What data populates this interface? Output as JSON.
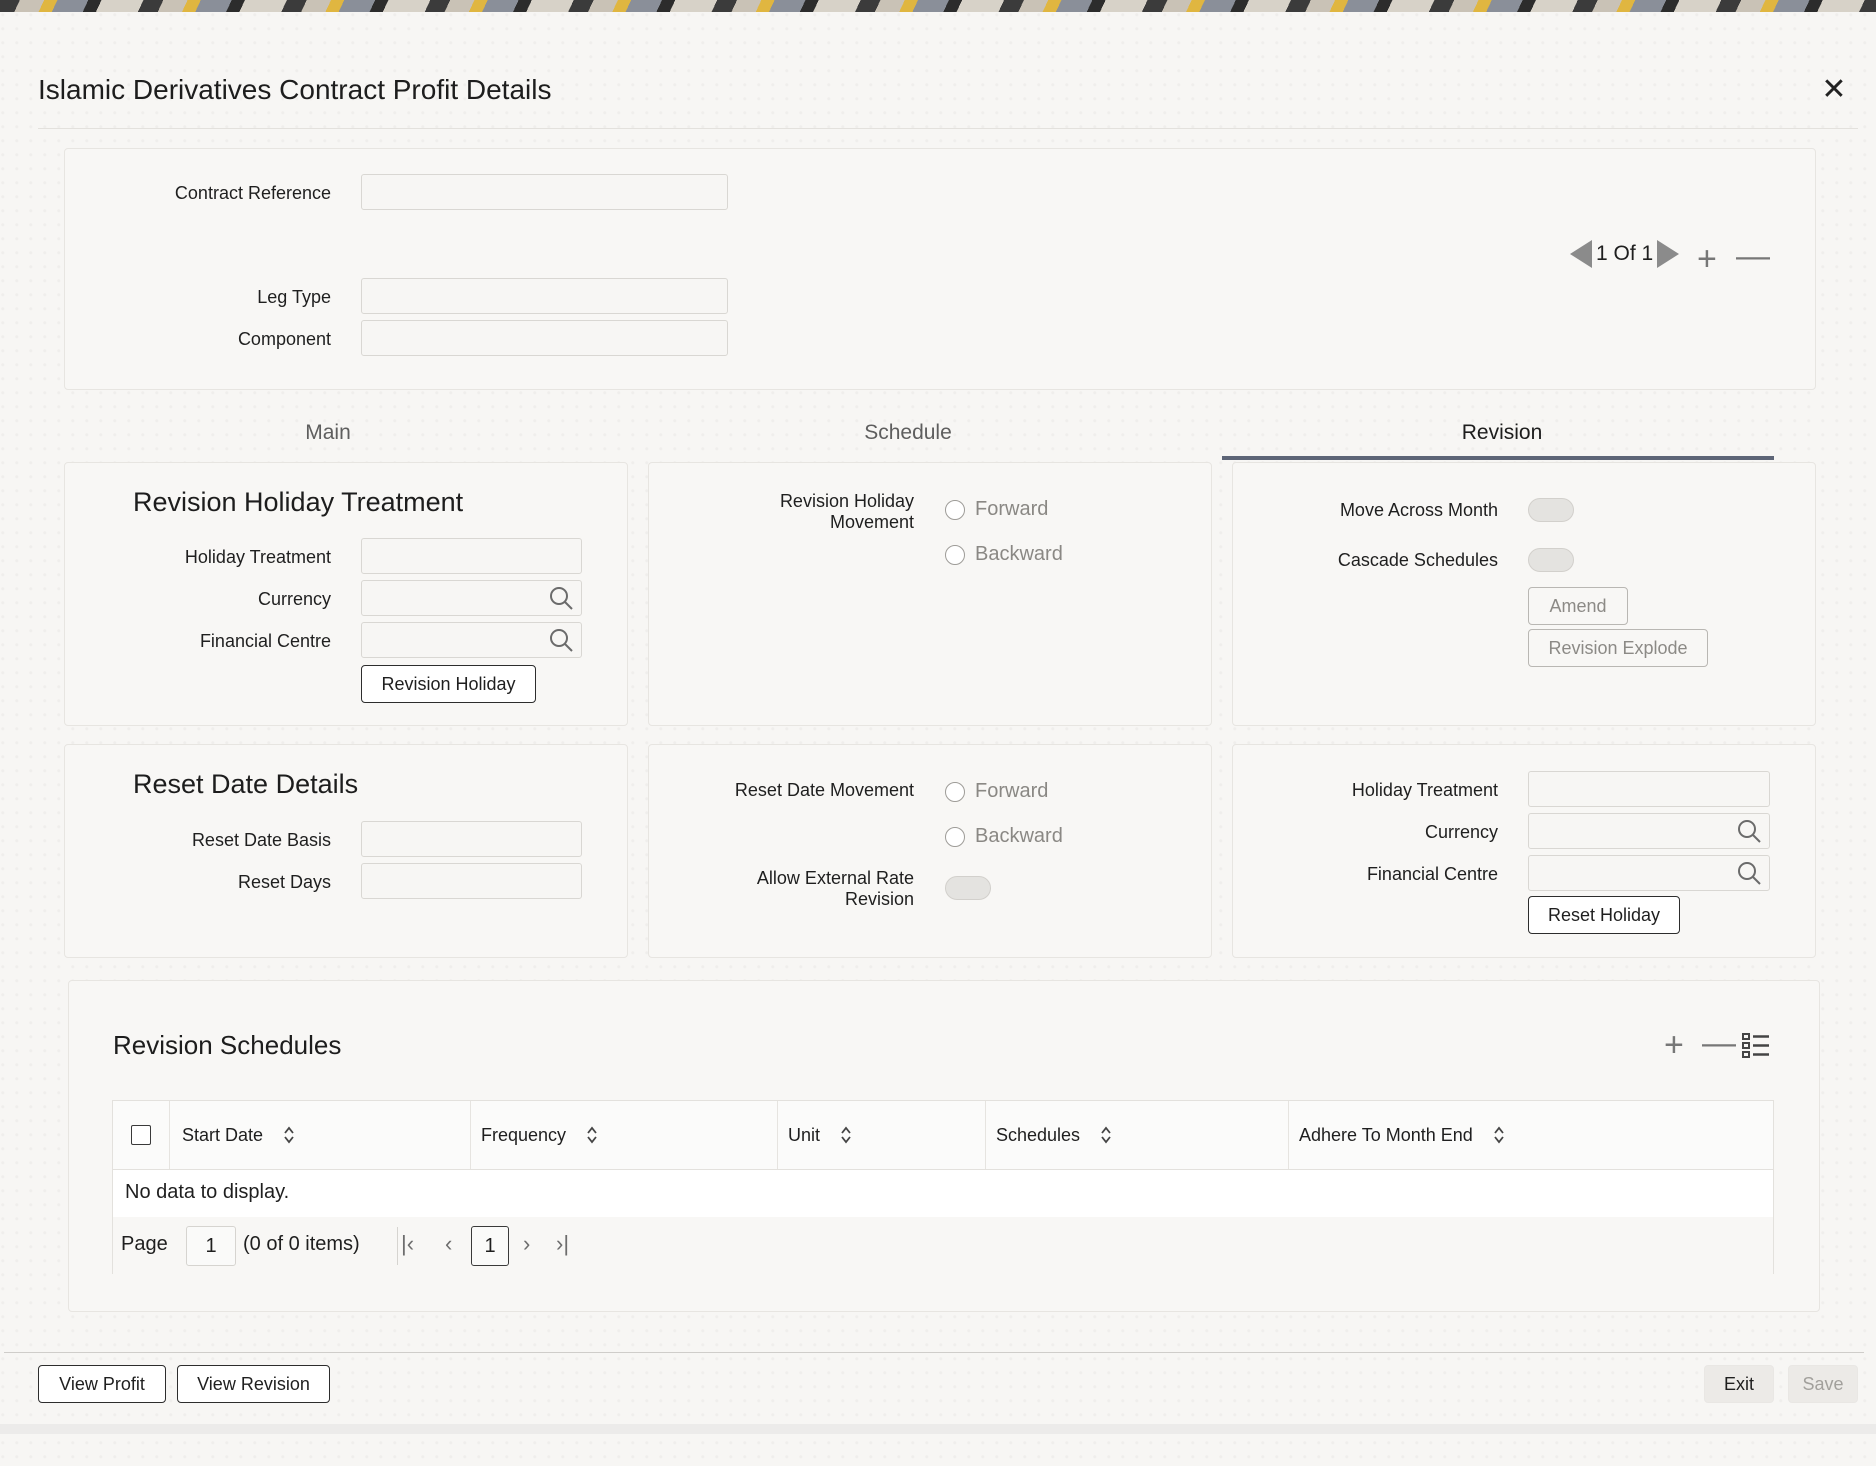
{
  "window": {
    "title": "Islamic Derivatives Contract Profit Details"
  },
  "header_fields": {
    "contract_reference_label": "Contract Reference",
    "leg_type_label": "Leg Type",
    "component_label": "Component",
    "record_pager": "1 Of 1"
  },
  "tabs": [
    {
      "label": "Main"
    },
    {
      "label": "Schedule"
    },
    {
      "label": "Revision"
    }
  ],
  "revision_holiday": {
    "heading": "Revision Holiday Treatment",
    "holiday_treatment_label": "Holiday Treatment",
    "currency_label": "Currency",
    "financial_centre_label": "Financial Centre",
    "button": "Revision Holiday",
    "movement_label": "Revision Holiday Movement",
    "forward": "Forward",
    "backward": "Backward",
    "move_across_month": "Move Across Month",
    "cascade_schedules": "Cascade Schedules",
    "amend": "Amend",
    "revision_explode": "Revision Explode"
  },
  "reset_date": {
    "heading": "Reset Date Details",
    "reset_date_basis_label": "Reset Date Basis",
    "reset_days_label": "Reset Days",
    "movement_label": "Reset Date Movement",
    "forward": "Forward",
    "backward": "Backward",
    "allow_external_label": "Allow External Rate Revision",
    "holiday_treatment_label": "Holiday Treatment",
    "currency_label": "Currency",
    "financial_centre_label": "Financial Centre",
    "button": "Reset Holiday"
  },
  "revision_schedules": {
    "heading": "Revision Schedules",
    "columns": [
      "Start Date",
      "Frequency",
      "Unit",
      "Schedules",
      "Adhere To Month End"
    ],
    "empty_text": "No data to display.",
    "page_label": "Page",
    "page_value": "1",
    "items_text": "(0 of 0 items)",
    "current_page": "1"
  },
  "footer": {
    "view_profit": "View Profit",
    "view_revision": "View Revision",
    "exit": "Exit",
    "save": "Save"
  },
  "colors": {
    "tab_underline": "#5d6577",
    "background": "#f7f6f4"
  }
}
